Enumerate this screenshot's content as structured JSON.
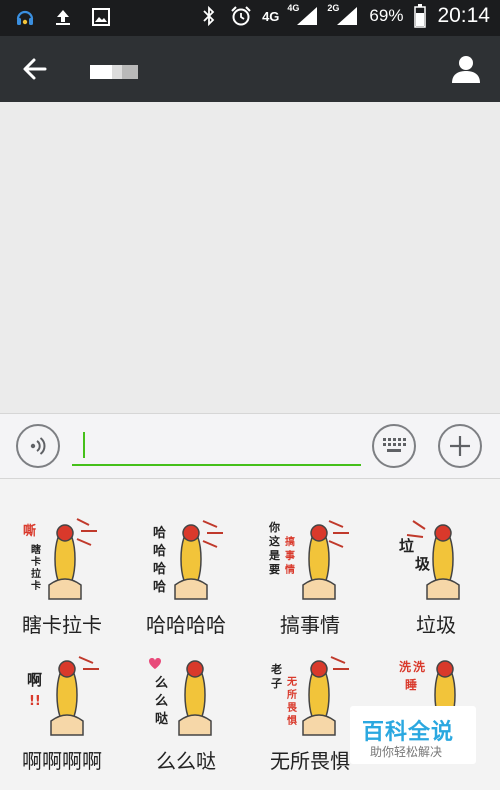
{
  "status_bar": {
    "network_primary": "4G",
    "network_secondary_1": "4G",
    "network_secondary_2": "2G",
    "battery": "69%",
    "time": "20:14",
    "icons": [
      "assistant-icon",
      "upload-icon",
      "image-icon",
      "bluetooth-icon",
      "alarm-icon",
      "signal-icon",
      "battery-icon"
    ]
  },
  "header": {
    "back_icon": "arrow-left-icon",
    "profile_icon": "person-icon"
  },
  "input_bar": {
    "voice_icon": "voice-icon",
    "keyboard_icon": "keyboard-icon",
    "plus_icon": "plus-icon",
    "text_value": ""
  },
  "stickers": [
    {
      "label": "瞎卡拉卡",
      "art_text": [
        "嘶",
        "瞎",
        "卡",
        "拉",
        "卡"
      ]
    },
    {
      "label": "哈哈哈哈",
      "art_text": [
        "哈",
        "哈",
        "哈",
        "哈"
      ]
    },
    {
      "label": "搞事情",
      "art_text": [
        "你",
        "这",
        "是",
        "要",
        "搞",
        "事",
        "情"
      ]
    },
    {
      "label": "垃圾",
      "art_text": [
        "垃",
        "圾"
      ]
    },
    {
      "label": "啊啊啊啊",
      "art_text": [
        "啊",
        "!!"
      ]
    },
    {
      "label": "么么哒",
      "art_text": [
        "么",
        "么",
        "哒"
      ]
    },
    {
      "label": "无所畏惧",
      "art_text": [
        "老",
        "子",
        "无",
        "所",
        "畏",
        "惧"
      ]
    },
    {
      "label": "",
      "art_text": [
        "洗",
        "洗",
        "睡"
      ]
    }
  ],
  "watermark": {
    "title": "百科全说",
    "subtitle": "助你轻松解决"
  },
  "colors": {
    "status_bar": "#1b1c1e",
    "title_bar": "#2e3134",
    "accent_green": "#45c01a",
    "chicken_yellow": "#f2c43a",
    "hand_skin": "#f6d7a8"
  }
}
